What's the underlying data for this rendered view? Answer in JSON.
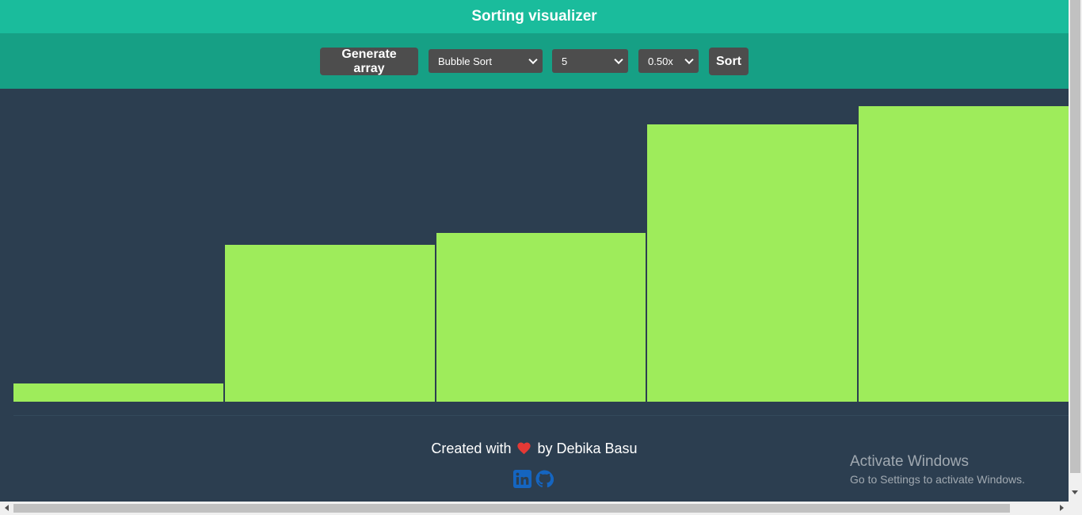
{
  "header": {
    "title": "Sorting visualizer"
  },
  "toolbar": {
    "generate_label": "Generate array",
    "algorithm_selected": "Bubble Sort",
    "size_selected": "5",
    "speed_selected": "0.50x",
    "sort_label": "Sort"
  },
  "chart_data": {
    "type": "bar",
    "values": [
      23,
      198,
      213,
      350,
      373
    ],
    "ylim": [
      0,
      395
    ],
    "bar_color": "#9eec5b"
  },
  "footer": {
    "credit_prefix": "Created with",
    "credit_suffix": "by Debika Basu",
    "icons": [
      "linkedin-icon",
      "github-icon"
    ],
    "heart_color": "#e53935",
    "icon_color": "#1565c0"
  },
  "watermark": {
    "line1": "Activate Windows",
    "line2": "Go to Settings to activate Windows."
  },
  "colors": {
    "header_bg": "#1abc9c",
    "toolbar_bg": "#16a085",
    "main_bg": "#2c3e50",
    "control_bg": "#4d4d4d"
  }
}
